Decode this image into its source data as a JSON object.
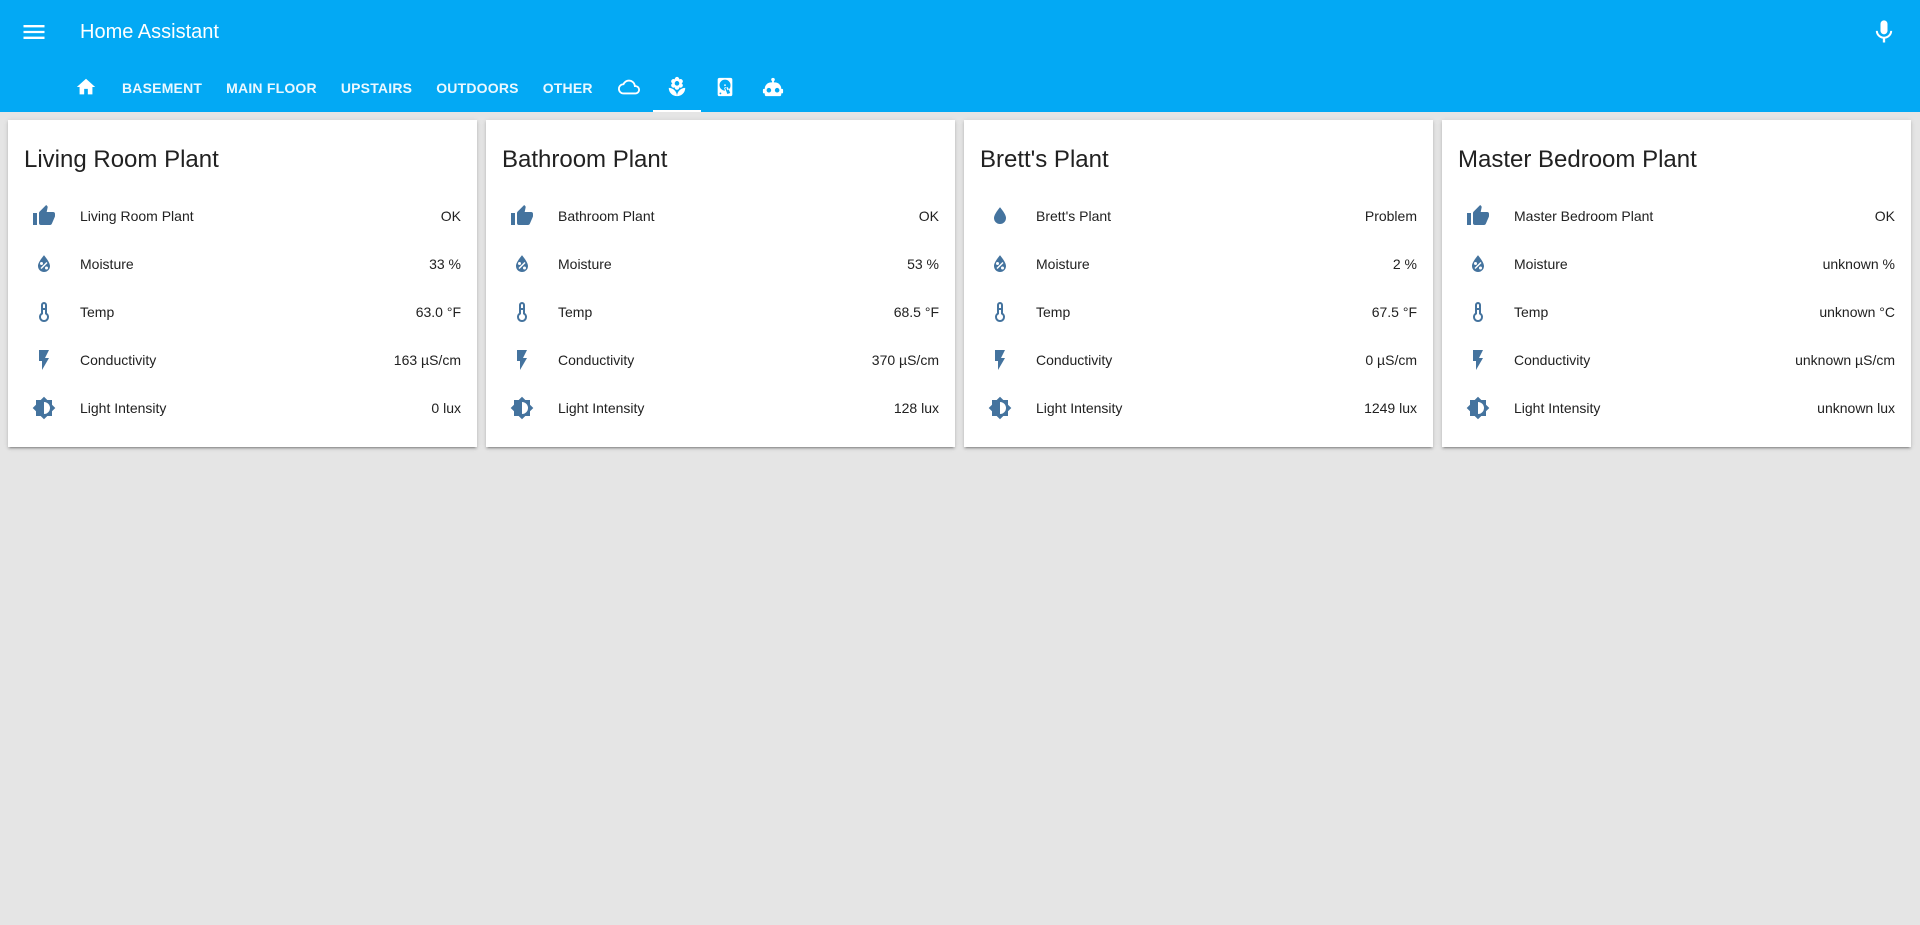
{
  "header": {
    "title": "Home Assistant",
    "menu_icon": "menu-icon",
    "mic_icon": "microphone-icon",
    "color": "#03a9f4"
  },
  "tabs": [
    {
      "icon": "home-icon",
      "label": ""
    },
    {
      "label": "BASEMENT"
    },
    {
      "label": "MAIN FLOOR"
    },
    {
      "label": "UPSTAIRS"
    },
    {
      "label": "OUTDOORS"
    },
    {
      "label": "OTHER"
    },
    {
      "icon": "cloud-icon",
      "label": ""
    },
    {
      "icon": "flower-icon",
      "label": "",
      "active": true
    },
    {
      "icon": "hard-disk-icon",
      "label": ""
    },
    {
      "icon": "robot-icon",
      "label": ""
    }
  ],
  "cards": [
    {
      "title": "Living Room Plant",
      "rows": [
        {
          "icon": "thumb-up-icon",
          "label": "Living Room Plant",
          "value": "OK"
        },
        {
          "icon": "water-percent-icon",
          "label": "Moisture",
          "value": "33 %"
        },
        {
          "icon": "thermometer-icon",
          "label": "Temp",
          "value": "63.0 °F"
        },
        {
          "icon": "flash-icon",
          "label": "Conductivity",
          "value": "163 µS/cm"
        },
        {
          "icon": "brightness-icon",
          "label": "Light Intensity",
          "value": "0 lux"
        }
      ]
    },
    {
      "title": "Bathroom Plant",
      "rows": [
        {
          "icon": "thumb-up-icon",
          "label": "Bathroom Plant",
          "value": "OK"
        },
        {
          "icon": "water-percent-icon",
          "label": "Moisture",
          "value": "53 %"
        },
        {
          "icon": "thermometer-icon",
          "label": "Temp",
          "value": "68.5 °F"
        },
        {
          "icon": "flash-icon",
          "label": "Conductivity",
          "value": "370 µS/cm"
        },
        {
          "icon": "brightness-icon",
          "label": "Light Intensity",
          "value": "128 lux"
        }
      ]
    },
    {
      "title": "Brett's Plant",
      "rows": [
        {
          "icon": "water-icon",
          "label": "Brett's Plant",
          "value": "Problem"
        },
        {
          "icon": "water-percent-icon",
          "label": "Moisture",
          "value": "2 %"
        },
        {
          "icon": "thermometer-icon",
          "label": "Temp",
          "value": "67.5 °F"
        },
        {
          "icon": "flash-icon",
          "label": "Conductivity",
          "value": "0 µS/cm"
        },
        {
          "icon": "brightness-icon",
          "label": "Light Intensity",
          "value": "1249 lux"
        }
      ]
    },
    {
      "title": "Master Bedroom Plant",
      "rows": [
        {
          "icon": "thumb-up-icon",
          "label": "Master Bedroom Plant",
          "value": "OK"
        },
        {
          "icon": "water-percent-icon",
          "label": "Moisture",
          "value": "unknown %"
        },
        {
          "icon": "thermometer-icon",
          "label": "Temp",
          "value": "unknown °C"
        },
        {
          "icon": "flash-icon",
          "label": "Conductivity",
          "value": "unknown µS/cm"
        },
        {
          "icon": "brightness-icon",
          "label": "Light Intensity",
          "value": "unknown lux"
        }
      ]
    }
  ],
  "colors": {
    "header": "#03a9f4",
    "background": "#e5e5e5",
    "icon": "#44739e"
  }
}
